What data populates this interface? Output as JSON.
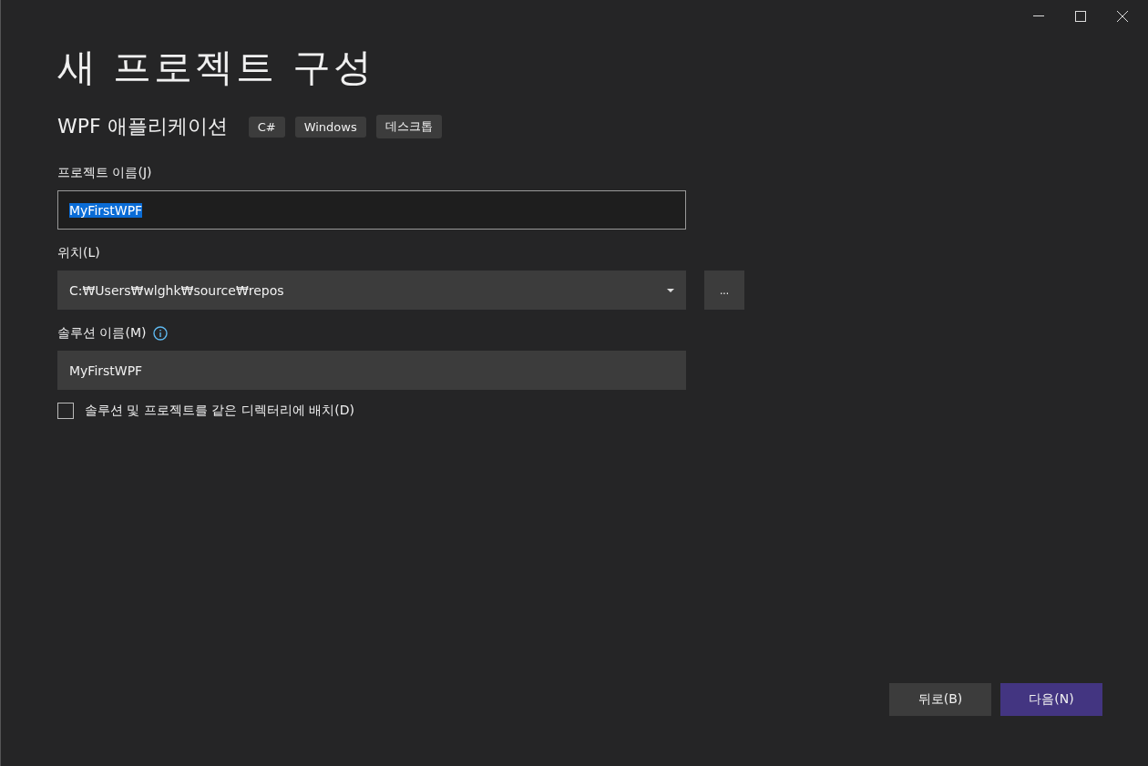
{
  "window": {
    "title": "새 프로젝트 구성"
  },
  "template": {
    "name": "WPF 애플리케이션",
    "tags": [
      "C#",
      "Windows",
      "데스크톱"
    ]
  },
  "fields": [
    {
      "kind": "text",
      "label": "프로젝트 이름(J)",
      "value": "MyFirstWPF",
      "focused": true,
      "text_selected": true
    },
    {
      "kind": "dropdown",
      "label": "위치(L)",
      "value": "C:₩Users₩wlghk₩source₩repos",
      "browse": "..."
    },
    {
      "kind": "text",
      "label": "솔루션 이름(M)",
      "value": "MyFirstWPF",
      "focused": false,
      "text_selected": false,
      "info": true
    }
  ],
  "checkbox": {
    "label": "솔루션 및 프로젝트를 같은 디렉터리에 배치(D)",
    "checked": false
  },
  "buttons": [
    {
      "label": "뒤로(B)",
      "kind": "secondary"
    },
    {
      "label": "다음(N)",
      "kind": "primary"
    }
  ]
}
